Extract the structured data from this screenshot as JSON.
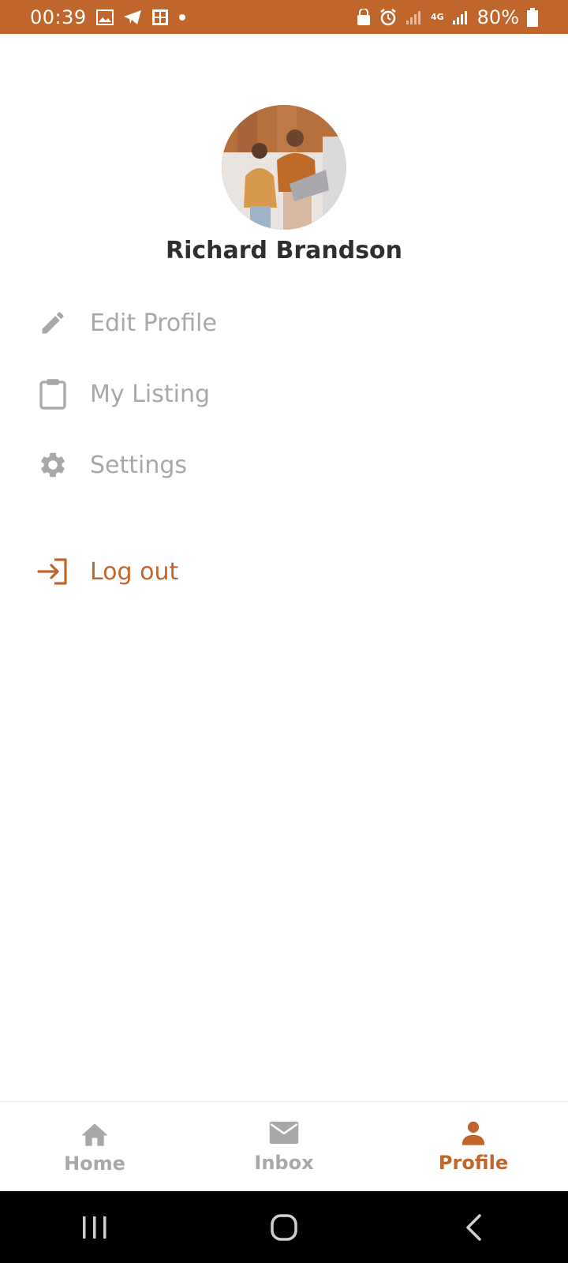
{
  "status_bar": {
    "time": "00:39",
    "battery": "80%",
    "network": "4G",
    "left_icons": [
      "gallery-icon",
      "telegram-icon",
      "sim-icon",
      "dot-icon"
    ],
    "right_icons": [
      "lock-icon",
      "alarm-icon",
      "signal-icon",
      "network-4g-icon",
      "signal-icon",
      "battery-icon"
    ]
  },
  "profile": {
    "name": "Richard Brandson",
    "avatar": "avatar-photo"
  },
  "menu": {
    "items": [
      {
        "label": "Edit Profile",
        "icon": "pencil-icon"
      },
      {
        "label": "My Listing",
        "icon": "clipboard-icon"
      },
      {
        "label": "Settings",
        "icon": "gear-icon"
      }
    ],
    "logout": {
      "label": "Log out",
      "icon": "logout-icon"
    }
  },
  "bottom_nav": {
    "items": [
      {
        "label": "Home",
        "icon": "home-icon",
        "active": false
      },
      {
        "label": "Inbox",
        "icon": "mail-icon",
        "active": false
      },
      {
        "label": "Profile",
        "icon": "person-icon",
        "active": true
      }
    ]
  },
  "colors": {
    "accent": "#c0652b",
    "inactive": "#a8a8ab",
    "text_dark": "#2f2f2f",
    "background": "#ffffff"
  }
}
